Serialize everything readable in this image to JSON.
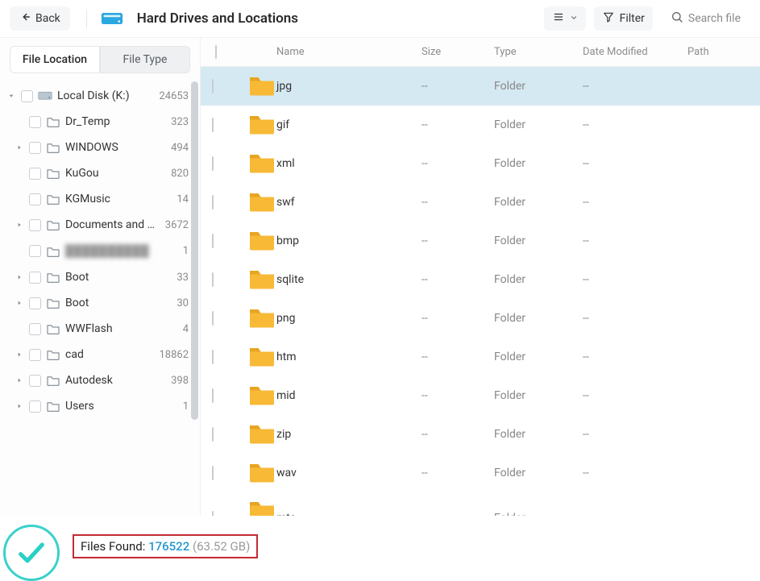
{
  "topbar": {
    "back_label": "Back",
    "title": "Hard Drives and Locations",
    "filter_label": "Filter",
    "search_placeholder": "Search file"
  },
  "tabs": {
    "location": "File Location",
    "type": "File Type"
  },
  "tree": {
    "root": {
      "label": "Local Disk (K:)",
      "count": "24653"
    },
    "items": [
      {
        "expand": false,
        "label": "Dr_Temp",
        "count": "323",
        "blurred": false
      },
      {
        "expand": true,
        "label": "WINDOWS",
        "count": "494",
        "blurred": false
      },
      {
        "expand": false,
        "label": "KuGou",
        "count": "820",
        "blurred": false
      },
      {
        "expand": false,
        "label": "KGMusic",
        "count": "14",
        "blurred": false
      },
      {
        "expand": true,
        "label": "Documents and Set...",
        "count": "3672",
        "blurred": false
      },
      {
        "expand": false,
        "label": "██████████",
        "count": "1",
        "blurred": true
      },
      {
        "expand": true,
        "label": "Boot",
        "count": "33",
        "blurred": false
      },
      {
        "expand": true,
        "label": "Boot",
        "count": "30",
        "blurred": false
      },
      {
        "expand": false,
        "label": "WWFlash",
        "count": "4",
        "blurred": false
      },
      {
        "expand": true,
        "label": "cad",
        "count": "18862",
        "blurred": false
      },
      {
        "expand": true,
        "label": "Autodesk",
        "count": "398",
        "blurred": false
      },
      {
        "expand": true,
        "label": "Users",
        "count": "1",
        "blurred": false
      }
    ]
  },
  "columns": {
    "name": "Name",
    "size": "Size",
    "type": "Type",
    "date": "Date Modified",
    "path": "Path"
  },
  "rows": [
    {
      "name": "jpg",
      "size": "--",
      "type": "Folder",
      "date": "--",
      "selected": true
    },
    {
      "name": "gif",
      "size": "--",
      "type": "Folder",
      "date": "--",
      "selected": false
    },
    {
      "name": "xml",
      "size": "--",
      "type": "Folder",
      "date": "--",
      "selected": false
    },
    {
      "name": "swf",
      "size": "--",
      "type": "Folder",
      "date": "--",
      "selected": false
    },
    {
      "name": "bmp",
      "size": "--",
      "type": "Folder",
      "date": "--",
      "selected": false
    },
    {
      "name": "sqlite",
      "size": "--",
      "type": "Folder",
      "date": "--",
      "selected": false
    },
    {
      "name": "png",
      "size": "--",
      "type": "Folder",
      "date": "--",
      "selected": false
    },
    {
      "name": "htm",
      "size": "--",
      "type": "Folder",
      "date": "--",
      "selected": false
    },
    {
      "name": "mid",
      "size": "--",
      "type": "Folder",
      "date": "--",
      "selected": false
    },
    {
      "name": "zip",
      "size": "--",
      "type": "Folder",
      "date": "--",
      "selected": false
    },
    {
      "name": "wav",
      "size": "--",
      "type": "Folder",
      "date": "--",
      "selected": false
    },
    {
      "name": "mts",
      "size": "--",
      "type": "Folder",
      "date": "--",
      "selected": false
    }
  ],
  "footer": {
    "found_label": "Files Found:",
    "count": "176522",
    "size": "(63.52 GB)"
  }
}
